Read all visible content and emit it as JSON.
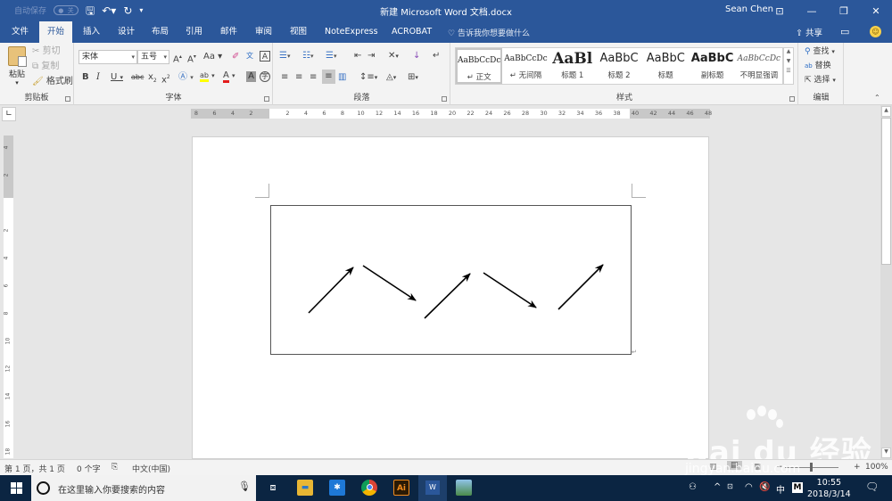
{
  "titlebar": {
    "autosave_label": "自动保存",
    "autosave_state": "关",
    "save_icon": "save-icon",
    "undo_icon": "undo-icon",
    "redo_icon": "redo-icon",
    "document_title": "新建 Microsoft Word 文档.docx",
    "user_name": "Sean Chen",
    "ribbon_display_icon": "ribbon-display-icon",
    "minimize": "—",
    "restore": "❐",
    "close": "✕"
  },
  "tabs": [
    {
      "label": "文件"
    },
    {
      "label": "开始",
      "active": true
    },
    {
      "label": "插入"
    },
    {
      "label": "设计"
    },
    {
      "label": "布局"
    },
    {
      "label": "引用"
    },
    {
      "label": "邮件"
    },
    {
      "label": "审阅"
    },
    {
      "label": "视图"
    },
    {
      "label": "NoteExpress"
    },
    {
      "label": "ACROBAT"
    }
  ],
  "tell_me": "告诉我你想要做什么",
  "share_label": "共享",
  "ribbon": {
    "clipboard": {
      "label": "剪贴板",
      "paste": "粘贴",
      "cut": "剪切",
      "copy": "复制",
      "format_painter": "格式刷"
    },
    "font": {
      "label": "字体",
      "font_name": "宋体",
      "font_size": "五号",
      "change_case": "Aa",
      "font_color": "#e31b1b",
      "highlight_color": "#ffff00"
    },
    "paragraph": {
      "label": "段落"
    },
    "styles": {
      "label": "样式",
      "items": [
        {
          "preview": "AaBbCcDc",
          "name": "↵ 正文",
          "active": true
        },
        {
          "preview": "AaBbCcDc",
          "name": "↵ 无间隔"
        },
        {
          "preview": "AaBl",
          "name": "标题 1"
        },
        {
          "preview": "AaBbC",
          "name": "标题 2"
        },
        {
          "preview": "AaBbC",
          "name": "标题"
        },
        {
          "preview": "AaBbC",
          "name": "副标题"
        },
        {
          "preview": "AaBbCcDc",
          "name": "不明显强调"
        }
      ]
    },
    "editing": {
      "label": "编辑",
      "find": "查找",
      "replace": "替换",
      "select": "选择"
    }
  },
  "ruler": {
    "horizontal_ticks": [
      "8",
      "6",
      "4",
      "2",
      "",
      "2",
      "4",
      "6",
      "8",
      "10",
      "12",
      "14",
      "16",
      "18",
      "20",
      "22",
      "24",
      "26",
      "28",
      "30",
      "32",
      "34",
      "36",
      "38",
      "40",
      "42",
      "44",
      "46",
      "48"
    ],
    "vertical_ticks": [
      "4",
      "2",
      "",
      "2",
      "4",
      "6",
      "8",
      "10",
      "12",
      "14",
      "16",
      "18"
    ]
  },
  "document": {
    "content": "text box containing five arrows alternating up-right and down-right in a zigzag pattern"
  },
  "statusbar": {
    "page": "第 1 页，共 1 页",
    "words": "0 个字",
    "language": "中文(中国)",
    "zoom": "100%",
    "zoom_percent": 100
  },
  "taskbar": {
    "search_placeholder": "在这里输入你要搜索的内容",
    "time": "10:55",
    "date": "2018/3/14",
    "ime": "中",
    "ime_mode": "M"
  },
  "watermark": {
    "brand": "Bai du 经验",
    "url": "jingyan.baidu.com"
  }
}
